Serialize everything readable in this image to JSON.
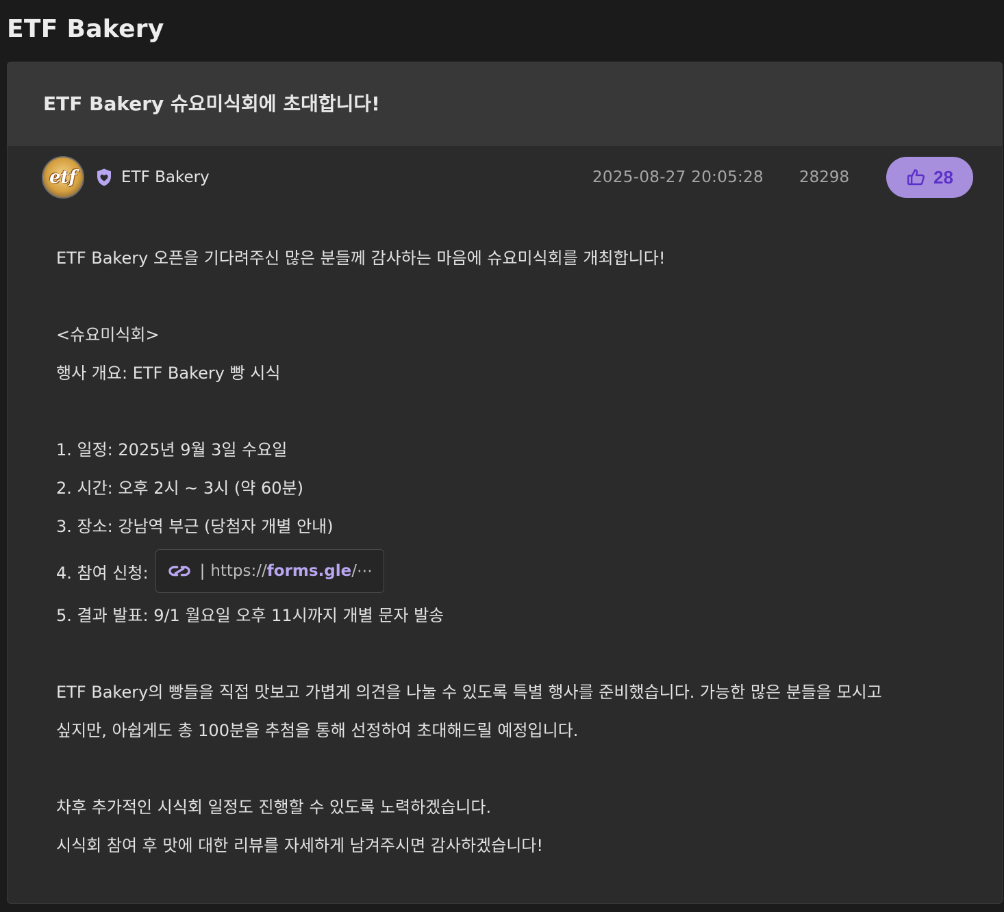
{
  "page": {
    "title": "ETF Bakery"
  },
  "post": {
    "title": "ETF Bakery 슈요미식회에 초대합니다!",
    "author": "ETF Bakery",
    "avatar_text": "etf",
    "date": "2025-08-27 20:05:28",
    "views": "28298",
    "likes": "28",
    "body": {
      "intro": "ETF Bakery 오픈을 기다려주신 많은 분들께 감사하는 마음에 슈요미식회를 개최합니다!",
      "section_title": "<슈요미식회>",
      "overview": "행사 개요: ETF Bakery 빵 시식",
      "item1": "1. 일정: 2025년 9월 3일 수요일",
      "item2": "2. 시간: 오후 2시 ~ 3시 (약 60분)",
      "item3": "3. 장소: 강남역 부근 (당첨자 개별 안내)",
      "item4_label": "4. 참여 신청:",
      "link": {
        "separator": "|",
        "prefix": "https://",
        "domain": "forms.gle",
        "suffix": "/⋯"
      },
      "item5": "5. 결과 발표: 9/1 월요일 오후 11시까지 개별 문자 발송",
      "para1_line1": "ETF Bakery의 빵들을 직접 맛보고 가볍게 의견을 나눌 수 있도록 특별 행사를 준비했습니다. 가능한 많은 분들을 모시고",
      "para1_line2": "싶지만, 아쉽게도 총 100분을 추첨을 통해 선정하여 초대해드릴 예정입니다.",
      "closing1": "차후 추가적인 시식회 일정도 진행할 수 있도록 노력하겠습니다.",
      "closing2": "시식회 참여 후 맛에 대한 리뷰를 자세하게 남겨주시면 감사하겠습니다!"
    }
  },
  "icons": {
    "badge": "shield-heart-icon",
    "like": "thumbs-up-icon",
    "link": "link-chain-icon"
  },
  "colors": {
    "background": "#1b1b1b",
    "card": "#2b2b2b",
    "card_header": "#383838",
    "accent": "#a88fde",
    "accent_text": "#5b32c8",
    "link_domain": "#b9a6f0"
  }
}
